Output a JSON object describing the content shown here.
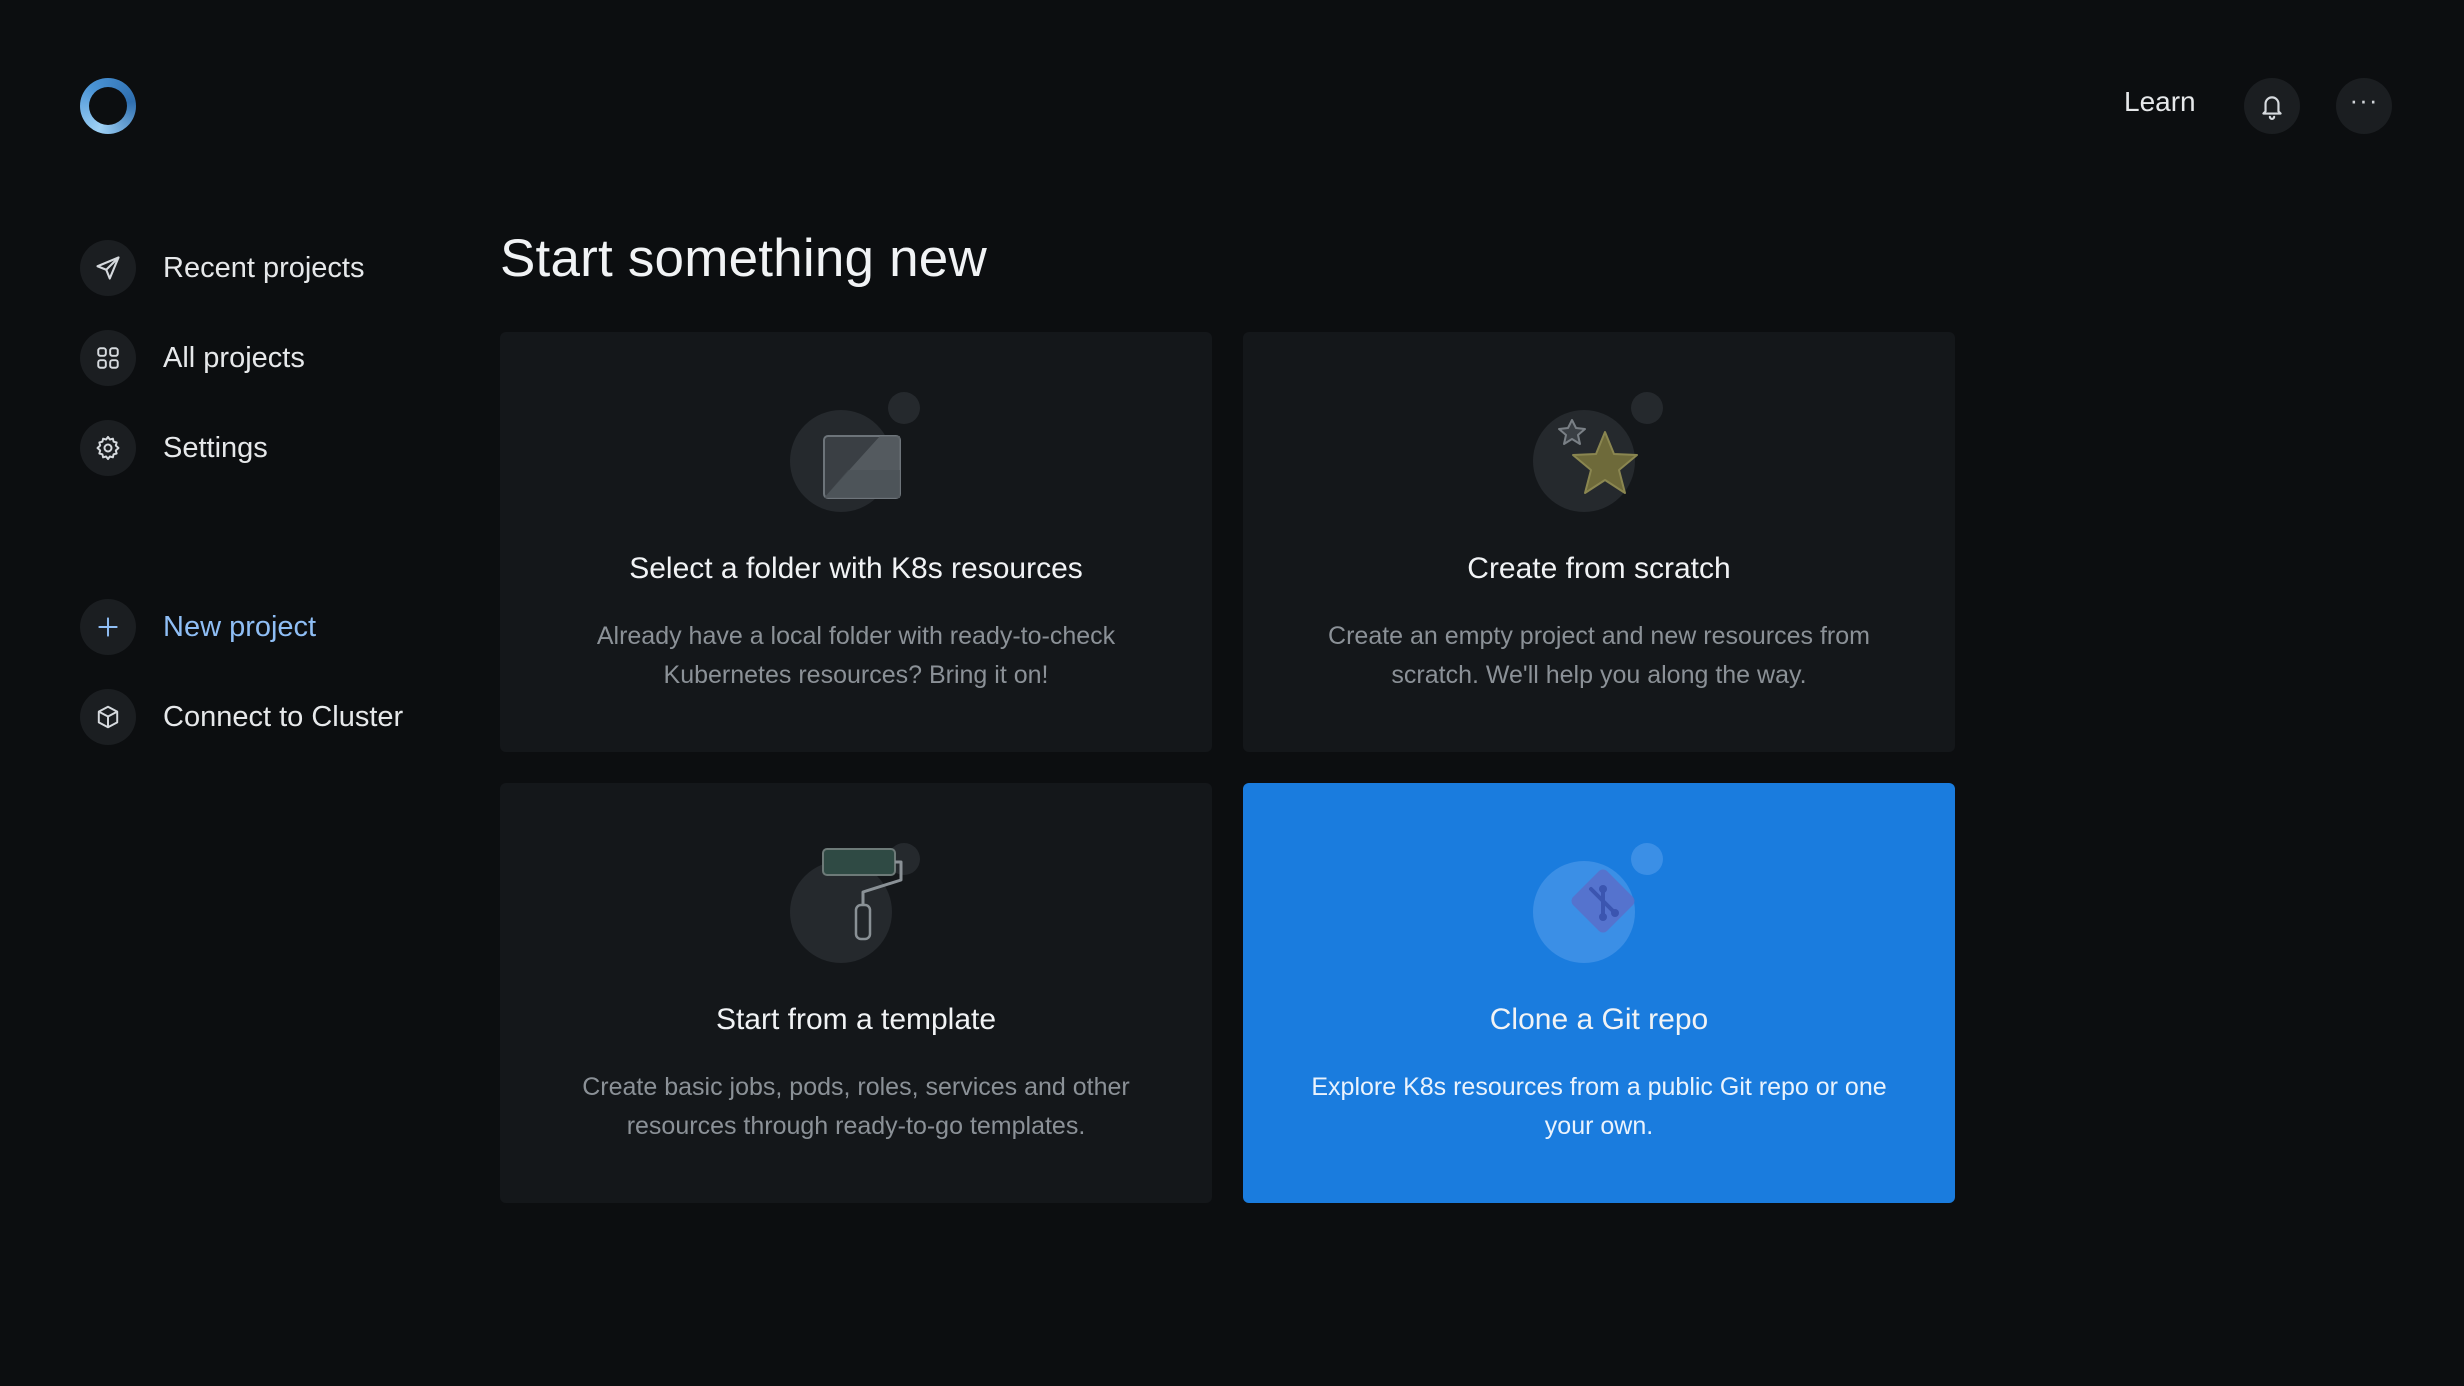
{
  "header": {
    "learn_label": "Learn",
    "notifications_icon": "bell-icon",
    "more_icon": "more-horizontal-icon",
    "more_glyph": "···"
  },
  "sidebar": {
    "items": [
      {
        "label": "Recent projects",
        "icon": "send-icon"
      },
      {
        "label": "All projects",
        "icon": "grid-icon"
      },
      {
        "label": "Settings",
        "icon": "gear-icon"
      },
      {
        "label": "New project",
        "icon": "plus-icon"
      },
      {
        "label": "Connect to Cluster",
        "icon": "cube-icon"
      }
    ]
  },
  "main": {
    "title": "Start something new",
    "cards": [
      {
        "title": "Select a folder with K8s resources",
        "description": "Already have a local folder with ready-to-check Kubernetes resources? Bring it on!",
        "icon": "folder-icon"
      },
      {
        "title": "Create from scratch",
        "description": "Create an empty project and new resources from scratch. We'll help you along the way.",
        "icon": "star-icon"
      },
      {
        "title": "Start from a template",
        "description": "Create basic jobs, pods, roles, services and other resources through ready-to-go templates.",
        "icon": "paint-roller-icon"
      },
      {
        "title": "Clone a Git repo",
        "description": "Explore K8s resources from a public Git repo or one your own.",
        "icon": "git-icon"
      }
    ]
  },
  "colors": {
    "background": "#0c0e10",
    "card": "#14171a",
    "primary_card": "#1a7cde",
    "accent_text": "#8fbef5"
  }
}
